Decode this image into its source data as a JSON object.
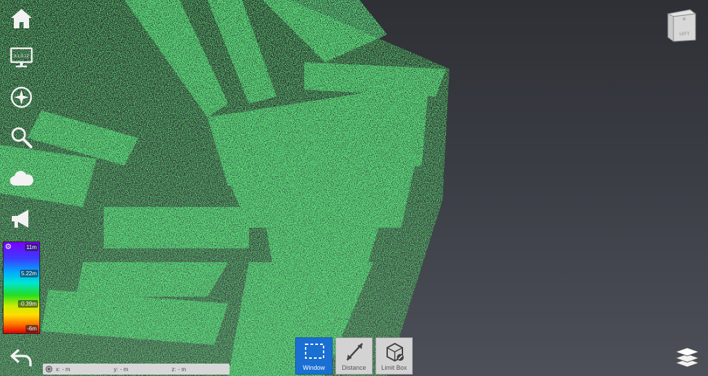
{
  "toolbar": {
    "items": [
      "home-icon",
      "display-settings-icon",
      "compass-icon",
      "search-icon",
      "cloud-icon",
      "announcement-icon"
    ],
    "monitor_text": "3.1.0.12"
  },
  "legend": {
    "max": "11m",
    "upper": "5.22m",
    "lower": "-0.39m",
    "min": "-6m",
    "gear_icon": "gear-icon"
  },
  "coords": {
    "x_label": "x:",
    "x_value": "-  m",
    "y_label": "y:",
    "y_value": "-  m",
    "z_label": "z:",
    "z_value": "-  m"
  },
  "bottom_tools": {
    "window": "Window",
    "distance": "Distance",
    "limit_box": "Limit Box"
  },
  "nav_cube": {
    "face_label": "LEFT"
  },
  "colors": {
    "point_green": "#27b83a",
    "active_blue": "#1a6fd2",
    "background_top": "#2e3035",
    "background_bottom": "#4d5058"
  }
}
